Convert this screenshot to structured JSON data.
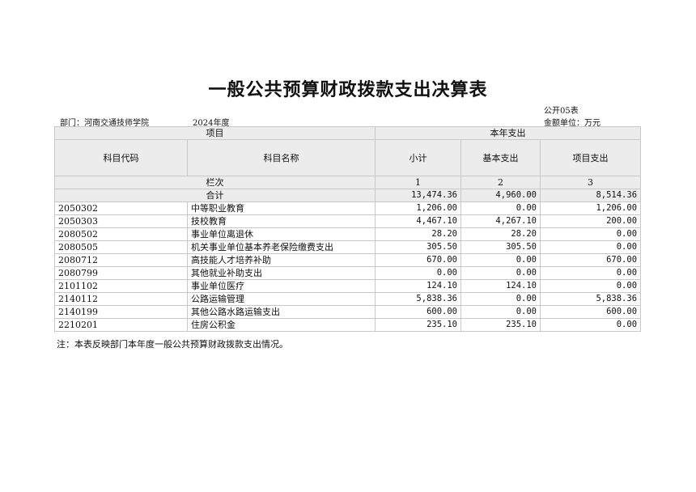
{
  "title": "一般公共预算财政拨款支出决算表",
  "form_no": "公开05表",
  "department": "部门：河南交通技师学院",
  "year": "2024年度",
  "unit": "金额单位：万元",
  "header": {
    "project": "项目",
    "current_year": "本年支出",
    "code": "科目代码",
    "name": "科目名称",
    "subtotal": "小计",
    "basic": "基本支出",
    "project_exp": "项目支出",
    "column_index": "栏次",
    "col1": "1",
    "col2": "2",
    "col3": "3"
  },
  "total": {
    "label": "合计",
    "subtotal": "13,474.36",
    "basic": "4,960.00",
    "project": "8,514.36"
  },
  "rows": [
    {
      "code": "2050302",
      "name": "中等职业教育",
      "subtotal": "1,206.00",
      "basic": "0.00",
      "project": "1,206.00"
    },
    {
      "code": "2050303",
      "name": "技校教育",
      "subtotal": "4,467.10",
      "basic": "4,267.10",
      "project": "200.00"
    },
    {
      "code": "2080502",
      "name": "事业单位离退休",
      "subtotal": "28.20",
      "basic": "28.20",
      "project": "0.00"
    },
    {
      "code": "2080505",
      "name": "机关事业单位基本养老保险缴费支出",
      "subtotal": "305.50",
      "basic": "305.50",
      "project": "0.00"
    },
    {
      "code": "2080712",
      "name": "高技能人才培养补助",
      "subtotal": "670.00",
      "basic": "0.00",
      "project": "670.00"
    },
    {
      "code": "2080799",
      "name": "其他就业补助支出",
      "subtotal": "0.00",
      "basic": "0.00",
      "project": "0.00"
    },
    {
      "code": "2101102",
      "name": "事业单位医疗",
      "subtotal": "124.10",
      "basic": "124.10",
      "project": "0.00"
    },
    {
      "code": "2140112",
      "name": "公路运输管理",
      "subtotal": "5,838.36",
      "basic": "0.00",
      "project": "5,838.36"
    },
    {
      "code": "2140199",
      "name": "其他公路水路运输支出",
      "subtotal": "600.00",
      "basic": "0.00",
      "project": "600.00"
    },
    {
      "code": "2210201",
      "name": "住房公积金",
      "subtotal": "235.10",
      "basic": "235.10",
      "project": "0.00"
    }
  ],
  "note": "注：本表反映部门本年度一般公共预算财政拨款支出情况。"
}
